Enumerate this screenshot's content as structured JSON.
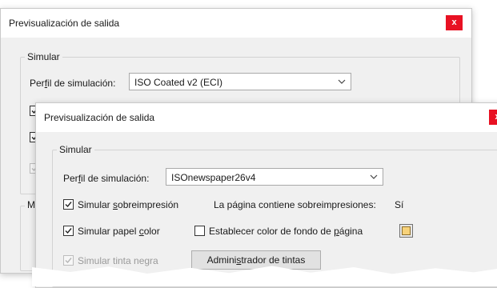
{
  "back_dialog": {
    "title": "Previsualización de salida",
    "close_label": "x",
    "group_label": "Simular",
    "profile_label_pre": "Per",
    "profile_label_u": "f",
    "profile_label_post": "il de simulación:",
    "profile_value": "ISO Coated v2 (ECI)",
    "partial_label": "Mo"
  },
  "front_dialog": {
    "title": "Previsualización de salida",
    "close_label": "x",
    "group_label": "Simular",
    "profile_label_pre": "Per",
    "profile_label_u": "f",
    "profile_label_post": "il de simulación:",
    "profile_value": "ISOnewspaper26v4",
    "overprint": {
      "pre": "Simular ",
      "u": "s",
      "post": "obreimpresión",
      "checked": true
    },
    "overprint_info_label": "La página contiene sobreimpresiones:",
    "overprint_info_value": "Sí",
    "paper_color": {
      "pre": "Simular papel ",
      "u": "c",
      "post": "olor",
      "checked": true
    },
    "page_bg": {
      "pre": "Establecer color de fondo de ",
      "u": "p",
      "post": "ágina",
      "checked": false
    },
    "page_bg_color": "#f7d27a",
    "black_ink": {
      "label": "Simular tinta negra",
      "checked": true,
      "disabled": true
    },
    "ink_manager": {
      "pre": "Admini",
      "u": "s",
      "post": "trador de tintas"
    }
  }
}
